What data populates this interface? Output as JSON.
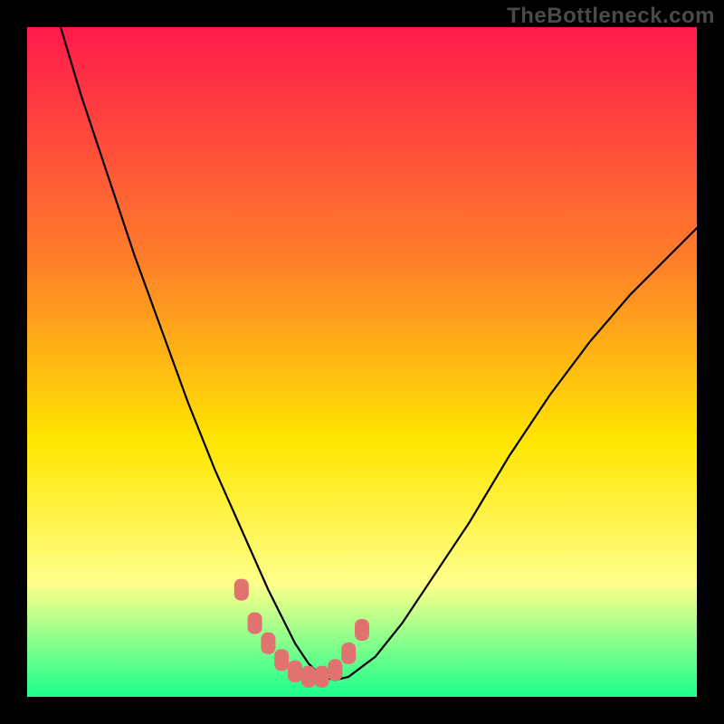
{
  "watermark": "TheBottleneck.com",
  "chart_data": {
    "type": "line",
    "title": "",
    "xlabel": "",
    "ylabel": "",
    "xlim": [
      0,
      100
    ],
    "ylim": [
      0,
      100
    ],
    "background_gradient": {
      "top": "#ff1a4b",
      "mid1": "#ff7f2a",
      "mid2": "#ffe600",
      "low": "#ffff8a",
      "bottom": "#19ff8c"
    },
    "series": [
      {
        "name": "bottleneck-curve",
        "x": [
          5,
          8,
          12,
          16,
          20,
          24,
          28,
          32,
          36,
          38,
          40,
          42,
          44,
          46,
          48,
          52,
          56,
          60,
          66,
          72,
          78,
          84,
          90,
          96,
          100
        ],
        "y": [
          100,
          90,
          78,
          66,
          55,
          44,
          34,
          25,
          16,
          12,
          8,
          5,
          3,
          2.5,
          3,
          6,
          11,
          17,
          26,
          36,
          45,
          53,
          60,
          66,
          70
        ]
      }
    ],
    "highlight_points": {
      "name": "marker-dots",
      "color": "#e0736f",
      "x": [
        32,
        34,
        36,
        38,
        40,
        42,
        44,
        46,
        48,
        50
      ],
      "y": [
        16,
        11,
        8,
        5.5,
        3.8,
        3,
        3,
        4,
        6.5,
        10
      ]
    }
  }
}
